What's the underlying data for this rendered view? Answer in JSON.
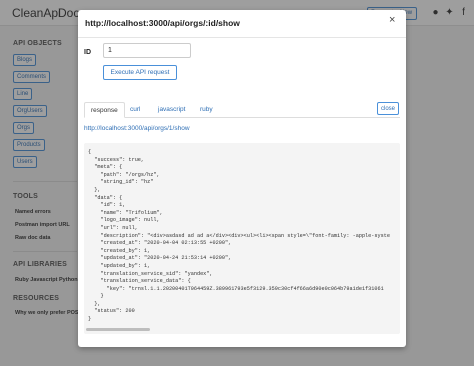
{
  "background": {
    "brand": "CleanApi",
    "brand_doc": "Doc",
    "top_button": "Request a New",
    "icons": [
      "github-icon",
      "twitter-icon",
      "facebook-icon"
    ],
    "sidebar": {
      "api_objects_heading": "API OBJECTS",
      "objects": [
        "Blogs",
        "Comments",
        "Line",
        "OrgUsers",
        "Orgs",
        "Products",
        "Users"
      ],
      "tools_heading": "TOOLS",
      "tools": [
        "Named errors",
        "Postman import URL",
        "Raw doc data"
      ],
      "libraries_heading": "API LIBRARIES",
      "libraries": "Ruby  Javascript  Python",
      "resources_heading": "RESOURCES",
      "resources": [
        "Why we only prefer POST"
      ]
    }
  },
  "modal": {
    "title": "http://localhost:3000/api/orgs/:id/show",
    "close_glyph": "×",
    "id_label": "ID",
    "id_value": "1",
    "execute_label": "Execute API request",
    "tabs": [
      "response",
      "curl",
      "javascript",
      "ruby"
    ],
    "active_tab": "response",
    "close_button": "close",
    "request_url": "http://localhost:3000/api/orgs/1/show",
    "response_lines": [
      "{",
      "  \"success\": true,",
      "  \"meta\": {",
      "    \"path\": \"/orgs/hz\",",
      "    \"string_id\": \"hz\"",
      "  },",
      "  \"data\": {",
      "    \"id\": 1,",
      "    \"name\": \"Trifolium\",",
      "    \"logo_image\": null,",
      "    \"url\": null,",
      "    \"description\": \"<div>asdasd ad ad a</div><div><ul><li><span style=\\\"font-family: -apple-syste",
      "    \"created_at\": \"2020-04-04 02:13:55 +0200\",",
      "    \"created_by\": 1,",
      "    \"updated_at\": \"2020-04-24 21:53:14 +0200\",",
      "    \"updated_by\": 1,",
      "    \"translation_service_sid\": \"yandex\",",
      "    \"translation_service_data\": {",
      "      \"key\": \"trnsl.1.1.20200401T064459Z.389961793e5f3129.359c30cf4f66a6d90e0c064b79a1de1f31061",
      "    }",
      "  },",
      "  \"status\": 200",
      "}"
    ]
  }
}
